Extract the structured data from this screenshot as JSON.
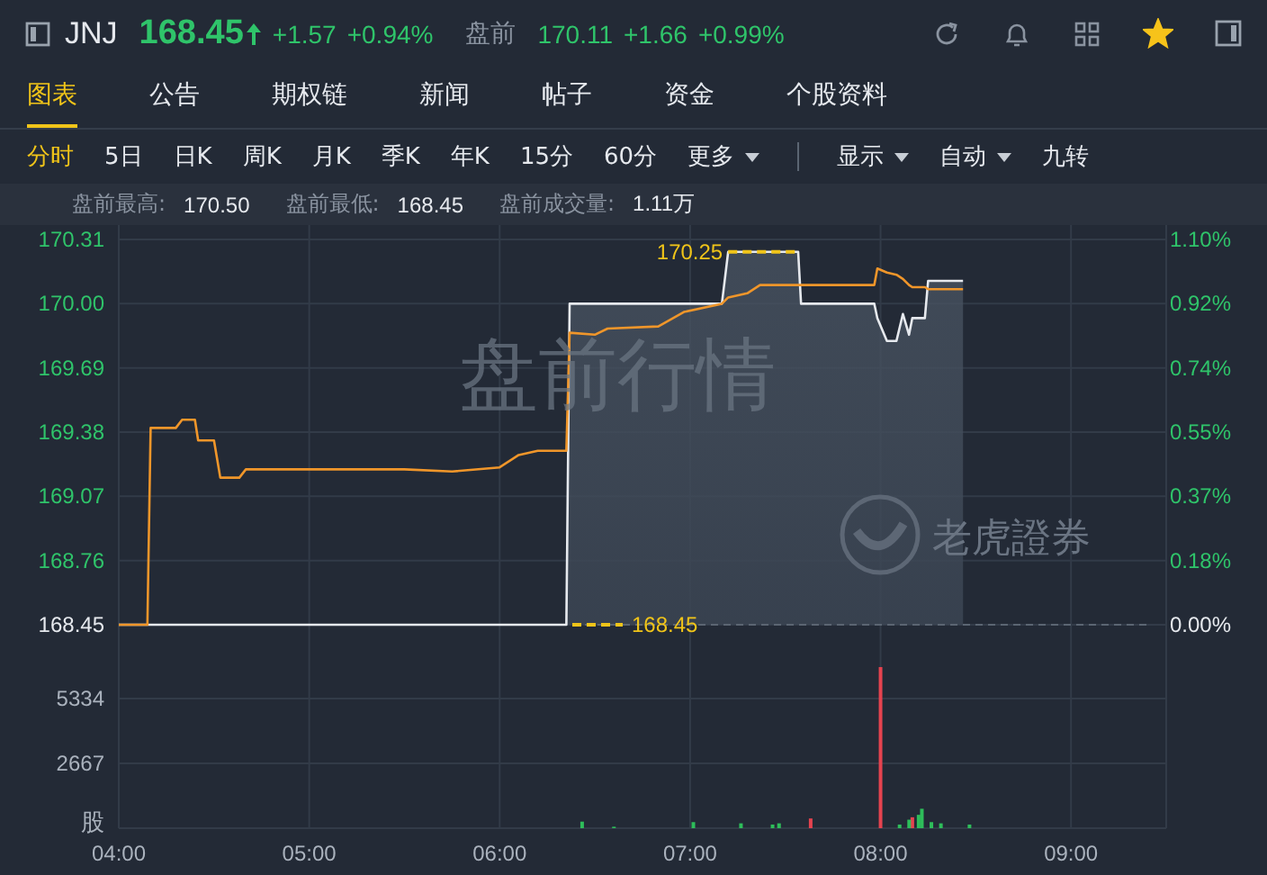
{
  "header": {
    "ticker": "JNJ",
    "price": "168.45",
    "change": "+1.57",
    "change_pct": "+0.94%",
    "premarket_label": "盘前",
    "premarket_price": "170.11",
    "premarket_change": "+1.66",
    "premarket_change_pct": "+0.99%",
    "favorite": true
  },
  "tabs": [
    {
      "label": "图表",
      "selected": true
    },
    {
      "label": "公告",
      "selected": false
    },
    {
      "label": "期权链",
      "selected": false
    },
    {
      "label": "新闻",
      "selected": false
    },
    {
      "label": "帖子",
      "selected": false
    },
    {
      "label": "资金",
      "selected": false
    },
    {
      "label": "个股资料",
      "selected": false
    }
  ],
  "periods": [
    {
      "label": "分时",
      "selected": true,
      "kind": "plain"
    },
    {
      "label": "5日",
      "selected": false,
      "kind": "plain"
    },
    {
      "label": "日K",
      "selected": false,
      "kind": "plain"
    },
    {
      "label": "周K",
      "selected": false,
      "kind": "plain"
    },
    {
      "label": "月K",
      "selected": false,
      "kind": "plain"
    },
    {
      "label": "季K",
      "selected": false,
      "kind": "plain"
    },
    {
      "label": "年K",
      "selected": false,
      "kind": "plain"
    },
    {
      "label": "15分",
      "selected": false,
      "kind": "plain"
    },
    {
      "label": "60分",
      "selected": false,
      "kind": "plain"
    },
    {
      "label": "更多",
      "selected": false,
      "kind": "menu"
    }
  ],
  "display_controls": [
    {
      "label": "显示",
      "kind": "menu"
    },
    {
      "label": "自动",
      "kind": "menu"
    },
    {
      "label": "九转",
      "kind": "plain"
    }
  ],
  "stats": [
    {
      "label": "盘前最高:",
      "value": "170.50"
    },
    {
      "label": "盘前最低:",
      "value": "168.45"
    },
    {
      "label": "盘前成交量:",
      "value": "1.11万"
    }
  ],
  "price_chart": {
    "session_label": "盘前行情",
    "brand": "老虎證券",
    "high_marker": "170.25",
    "low_marker": "168.45",
    "percent_ticks": [
      "1.10%",
      "0.92%",
      "0.74%",
      "0.55%",
      "0.37%",
      "0.18%",
      "0.00%"
    ],
    "chart_data": {
      "type": "line",
      "grid": true,
      "xlim": [
        4,
        9.5
      ],
      "ylim": [
        168.45,
        170.31
      ],
      "yticks": [
        {
          "value": 168.45,
          "label": "168.45"
        },
        {
          "value": 168.76,
          "label": "168.76"
        },
        {
          "value": 169.07,
          "label": "169.07"
        },
        {
          "value": 169.38,
          "label": "169.38"
        },
        {
          "value": 169.69,
          "label": "169.69"
        },
        {
          "value": 170,
          "label": "170.00"
        },
        {
          "value": 170.31,
          "label": "170.31"
        }
      ],
      "x": [
        4,
        4.15,
        4.167,
        4.3,
        4.333,
        4.4,
        4.417,
        4.5,
        4.533,
        4.633,
        4.667,
        5.5,
        5.75,
        6,
        6.1,
        6.2,
        6.35,
        6.367,
        6.5,
        6.567,
        6.833,
        6.967,
        7.167,
        7.2,
        7.3,
        7.367,
        7.567,
        7.583,
        7.967,
        7.983,
        8.033,
        8.083,
        8.117,
        8.15,
        8.167,
        8.233,
        8.25,
        8.433
      ],
      "series": [
        {
          "color": "#e6e9ee",
          "values": [
            168.45,
            168.45,
            168.45,
            168.45,
            168.45,
            168.45,
            168.45,
            168.45,
            168.45,
            168.45,
            168.45,
            168.45,
            168.45,
            168.45,
            168.45,
            168.45,
            168.45,
            170.0,
            170.0,
            170.0,
            170.0,
            170.0,
            170.0,
            170.25,
            170.25,
            170.25,
            170.25,
            170.0,
            170.0,
            169.93,
            169.82,
            169.82,
            169.95,
            169.85,
            169.93,
            169.93,
            170.11,
            170.11
          ]
        },
        {
          "color": "#f0962a",
          "values": [
            168.45,
            168.45,
            169.4,
            169.4,
            169.44,
            169.44,
            169.34,
            169.34,
            169.16,
            169.16,
            169.2,
            169.2,
            169.19,
            169.21,
            169.27,
            169.29,
            169.29,
            169.86,
            169.85,
            169.88,
            169.89,
            169.96,
            170.0,
            170.03,
            170.05,
            170.09,
            170.09,
            170.09,
            170.09,
            170.17,
            170.15,
            170.14,
            170.12,
            170.09,
            170.08,
            170.08,
            170.07,
            170.07
          ]
        }
      ]
    }
  },
  "volume_chart": {
    "unit_label": "股",
    "chart_data": {
      "type": "bar",
      "grid": true,
      "xlim": [
        4,
        9.5
      ],
      "ylim": [
        0,
        7779
      ],
      "yticks": [
        2667,
        5334
      ],
      "xticks": [
        {
          "value": 4,
          "label": "04:00"
        },
        {
          "value": 5,
          "label": "05:00"
        },
        {
          "value": 6,
          "label": "06:00"
        },
        {
          "value": 7,
          "label": "07:00"
        },
        {
          "value": 8,
          "label": "08:00"
        },
        {
          "value": 9,
          "label": "09:00"
        }
      ],
      "x": [
        6.433,
        6.6,
        7.017,
        7.267,
        7.433,
        7.467,
        7.633,
        8,
        8.1,
        8.15,
        8.167,
        8.2,
        8.217,
        8.267,
        8.317,
        8.467
      ],
      "series": [
        {
          "color": "#e5434f",
          "values": [
            null,
            null,
            null,
            null,
            null,
            null,
            400,
            6630,
            null,
            null,
            450,
            null,
            null,
            null,
            null,
            null
          ]
        },
        {
          "color": "#2ebd5a",
          "values": [
            270,
            60,
            250,
            200,
            150,
            200,
            null,
            null,
            150,
            350,
            null,
            550,
            800,
            250,
            200,
            150
          ]
        }
      ]
    }
  }
}
